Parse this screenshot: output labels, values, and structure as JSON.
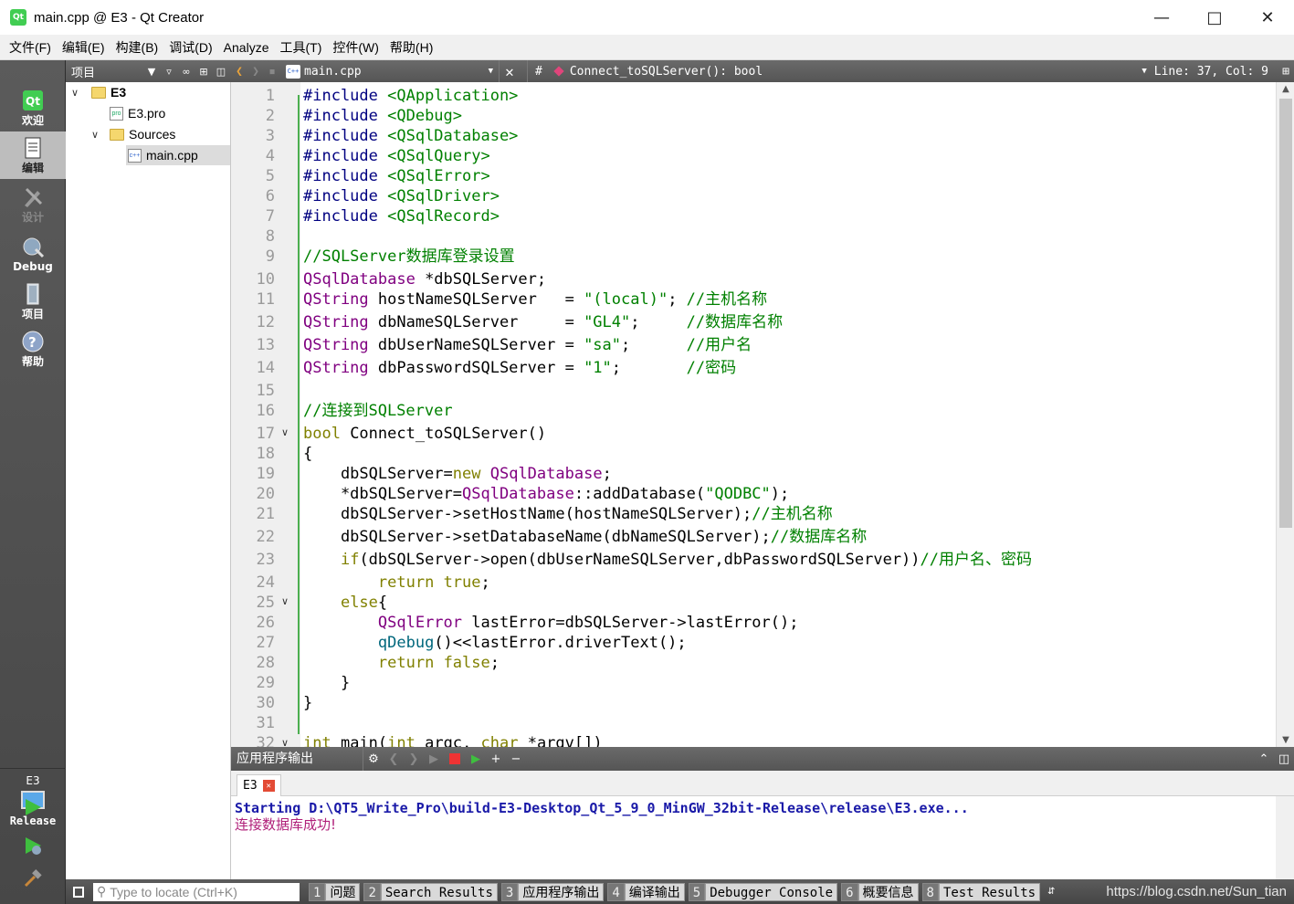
{
  "window": {
    "title": "main.cpp @ E3 - Qt Creator",
    "controls": [
      "minimize",
      "maximize",
      "close"
    ]
  },
  "menubar": [
    "文件(F)",
    "编辑(E)",
    "构建(B)",
    "调试(D)",
    "Analyze",
    "工具(T)",
    "控件(W)",
    "帮助(H)"
  ],
  "modes": [
    {
      "label": "欢迎",
      "icon": "qt-logo-icon",
      "state": "normal"
    },
    {
      "label": "编辑",
      "icon": "edit-document-icon",
      "state": "active"
    },
    {
      "label": "设计",
      "icon": "design-pen-icon",
      "state": "disabled"
    },
    {
      "label": "Debug",
      "icon": "debug-bug-icon",
      "state": "normal"
    },
    {
      "label": "项目",
      "icon": "project-wrench-icon",
      "state": "normal"
    },
    {
      "label": "帮助",
      "icon": "help-question-icon",
      "state": "normal"
    }
  ],
  "kit": {
    "project": "E3",
    "build": "Release"
  },
  "project_panel": {
    "title": "项目",
    "tree": [
      {
        "label": "E3",
        "level": 0,
        "expanded": true,
        "type": "project"
      },
      {
        "label": "E3.pro",
        "level": 1,
        "type": "pro-file"
      },
      {
        "label": "Sources",
        "level": 1,
        "expanded": true,
        "type": "folder"
      },
      {
        "label": "main.cpp",
        "level": 2,
        "type": "cpp-file",
        "selected": true
      }
    ]
  },
  "editor_toolbar": {
    "file": "main.cpp",
    "hash": "#",
    "symbol": "Connect_toSQLServer(): bool",
    "position": "Line: 37, Col: 9"
  },
  "editor": {
    "line_numbers": [
      "1",
      "2",
      "3",
      "4",
      "5",
      "6",
      "7",
      "8",
      "9",
      "10",
      "11",
      "12",
      "13",
      "14",
      "15",
      "16",
      "17",
      "18",
      "19",
      "20",
      "21",
      "22",
      "23",
      "24",
      "25",
      "26",
      "27",
      "28",
      "29",
      "30",
      "31",
      "32"
    ],
    "fold_lines": [
      "17",
      "25",
      "32"
    ],
    "code": {
      "l1a": "#include",
      "l1b": " <QApplication>",
      "l2a": "#include",
      "l2b": " <QDebug>",
      "l3a": "#include",
      "l3b": " <QSqlDatabase>",
      "l4a": "#include",
      "l4b": " <QSqlQuery>",
      "l5a": "#include",
      "l5b": " <QSqlError>",
      "l6a": "#include",
      "l6b": " <QSqlDriver>",
      "l7a": "#include",
      "l7b": " <QSqlRecord>",
      "l9": "//SQLServer数据库登录设置",
      "l10a": "QSqlDatabase",
      "l10b": " *dbSQLServer;",
      "l11a": "QString",
      "l11b": " hostNameSQLServer   = ",
      "l11c": "\"(local)\"",
      "l11d": "; ",
      "l11e": "//主机名称",
      "l12a": "QString",
      "l12b": " dbNameSQLServer     = ",
      "l12c": "\"GL4\"",
      "l12d": ";     ",
      "l12e": "//数据库名称",
      "l13a": "QString",
      "l13b": " dbUserNameSQLServer = ",
      "l13c": "\"sa\"",
      "l13d": ";      ",
      "l13e": "//用户名",
      "l14a": "QString",
      "l14b": " dbPasswordSQLServer = ",
      "l14c": "\"1\"",
      "l14d": ";       ",
      "l14e": "//密码",
      "l16": "//连接到SQLServer",
      "l17a": "bool",
      "l17b": " Connect_toSQLServer()",
      "l18": "{",
      "l19a": "    dbSQLServer=",
      "l19b": "new",
      "l19c": " ",
      "l19d": "QSqlDatabase",
      "l19e": ";",
      "l20a": "    *dbSQLServer=",
      "l20b": "QSqlDatabase",
      "l20c": "::addDatabase(",
      "l20d": "\"QODBC\"",
      "l20e": ");",
      "l21a": "    dbSQLServer->setHostName(hostNameSQLServer);",
      "l21b": "//主机名称",
      "l22a": "    dbSQLServer->setDatabaseName(dbNameSQLServer);",
      "l22b": "//数据库名称",
      "l23a": "    ",
      "l23b": "if",
      "l23c": "(dbSQLServer->open(dbUserNameSQLServer,dbPasswordSQLServer))",
      "l23d": "//用户名、密码",
      "l24a": "        ",
      "l24b": "return",
      "l24c": " ",
      "l24d": "true",
      "l24e": ";",
      "l25a": "    ",
      "l25b": "else",
      "l25c": "{",
      "l26a": "        ",
      "l26b": "QSqlError",
      "l26c": " lastError=dbSQLServer->lastError();",
      "l27a": "        ",
      "l27b": "qDebug",
      "l27c": "()<<lastError.driverText();",
      "l28a": "        ",
      "l28b": "return",
      "l28c": " ",
      "l28d": "false",
      "l28e": ";",
      "l29": "    }",
      "l30": "}",
      "l32a": "int",
      "l32b": " main(",
      "l32c": "int",
      "l32d": " argc, ",
      "l32e": "char",
      "l32f": " *argv[])"
    }
  },
  "output": {
    "title": "应用程序输出",
    "tab": "E3",
    "lines": [
      "Starting D:\\QT5_Write_Pro\\build-E3-Desktop_Qt_5_9_0_MinGW_32bit-Release\\release\\E3.exe...",
      "连接数据库成功!"
    ]
  },
  "statusbar": {
    "locator_placeholder": "Type to locate (Ctrl+K)",
    "panes": [
      {
        "num": "1",
        "label": "问题"
      },
      {
        "num": "2",
        "label": "Search Results"
      },
      {
        "num": "3",
        "label": "应用程序输出"
      },
      {
        "num": "4",
        "label": "编译输出"
      },
      {
        "num": "5",
        "label": "Debugger Console"
      },
      {
        "num": "6",
        "label": "概要信息"
      },
      {
        "num": "8",
        "label": "Test Results"
      }
    ],
    "watermark": "https://blog.csdn.net/Sun_tian"
  },
  "colors": {
    "keyword": "#808000",
    "preprocessor": "#000080",
    "class": "#800080",
    "string_comment": "#008000",
    "output_start": "#1a1aa8",
    "output_msg": "#b0207a"
  }
}
